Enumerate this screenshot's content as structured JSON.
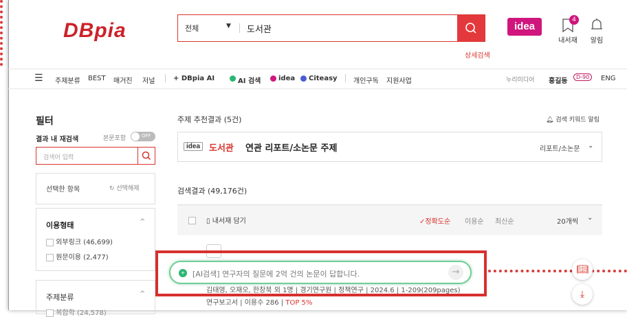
{
  "brand": {
    "logo": "DBpia",
    "accent": "#d9342c",
    "idea_color": "#d0167d"
  },
  "search": {
    "scope": "전체",
    "query": "도서관",
    "advanced": "상세검색"
  },
  "header_right": {
    "idea": "idea",
    "library": {
      "label": "내서재",
      "count": "4"
    },
    "alerts": {
      "label": "알림"
    }
  },
  "nav": {
    "items": [
      "주제분류",
      "BEST",
      "매거진",
      "저널"
    ],
    "special": [
      "+ DBpia AI",
      "AI 검색",
      "idea",
      "Citeasy"
    ],
    "extras": [
      "개인구독",
      "지원사업"
    ],
    "right": {
      "org": "누리미디어",
      "user": "홍길동",
      "badge": "D-90",
      "lang": "ENG"
    }
  },
  "sidebar": {
    "title": "필터",
    "within_label": "결과 내 재검색",
    "include_body": "본문포함",
    "toggle": "OFF",
    "within_placeholder": "검색어 입력",
    "selected_label": "선택한 항목",
    "clear_label": "선택해제",
    "usage": {
      "title": "이용형태",
      "options": [
        {
          "label": "외부링크 (46,699)"
        },
        {
          "label": "원문이용 (2,477)"
        }
      ]
    },
    "subject": {
      "title": "주제분류",
      "first_option": "복합학 (24,578)"
    }
  },
  "main": {
    "recommend_title": "주제 추천결과 (5건)",
    "keyword_alert": "검색 키워드 알림",
    "idea_tag": "idea",
    "idea_keyword": "도서관",
    "idea_text": "연관 리포트/소논문 주제",
    "idea_type": "리포트/소논문",
    "results_title": "검색결과 (49,176건)",
    "save_library": "내서재 담기",
    "sort": [
      "정확도순",
      "이용순",
      "최신순"
    ],
    "page_size": "20개씩",
    "result": {
      "meta": [
        "김태영, 오재오, 한창북 외 1명",
        "경기연구원",
        "정책연구",
        "2024.6",
        "1-209(209pages)"
      ],
      "tags": [
        "연구보고서",
        "이용수 286",
        "TOP 5%"
      ]
    },
    "ai_banner": "[AI검색] 연구자의 질문에 2억 건의 논문이 답합니다."
  }
}
